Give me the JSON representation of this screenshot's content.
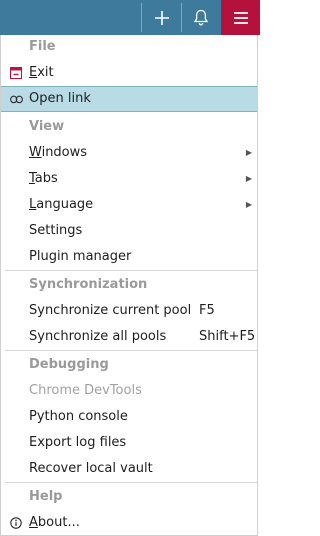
{
  "colors": {
    "topbar": "#3d7a9b",
    "menu_button": "#b4123d",
    "highlight": "#b8dbe6"
  },
  "topbar": {
    "add_icon": "plus-icon",
    "notifications_icon": "bell-icon",
    "menu_icon": "hamburger-menu-icon"
  },
  "menu": {
    "file": {
      "header": "File",
      "exit": {
        "first": "E",
        "rest": "xit",
        "icon": "exit-icon"
      },
      "open_link": {
        "label": "Open link",
        "icon": "link-icon"
      }
    },
    "view": {
      "header": "View",
      "windows": {
        "first": "W",
        "rest": "indows"
      },
      "tabs": {
        "first": "T",
        "rest": "abs"
      },
      "language": {
        "first": "L",
        "rest": "anguage"
      },
      "settings": "Settings",
      "plugin_manager": "Plugin manager"
    },
    "sync": {
      "header": "Synchronization",
      "current_pool": {
        "label": "Synchronize current pool",
        "shortcut": "F5"
      },
      "all_pools": {
        "label": "Synchronize all pools",
        "shortcut": "Shift+F5"
      }
    },
    "debugging": {
      "header": "Debugging",
      "devtools": "Chrome DevTools",
      "python_console": "Python console",
      "export_logs": "Export log files",
      "recover_vault": "Recover local vault"
    },
    "help": {
      "header": "Help",
      "about": {
        "first": "A",
        "rest": "bout...",
        "icon": "info-icon"
      }
    }
  }
}
